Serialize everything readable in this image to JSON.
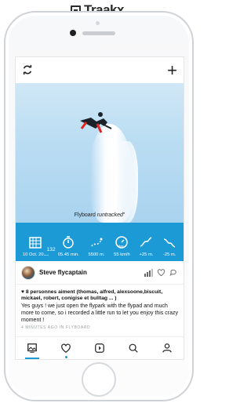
{
  "brand": {
    "name": "Traakx"
  },
  "header": {
    "sync_icon": "refresh-icon",
    "add_label": "+"
  },
  "photo": {
    "caption_label": "Flyboard",
    "caption_status": "runtracked"
  },
  "stats": [
    {
      "label": "10 Oct. 2016",
      "icon": "calendar-icon"
    },
    {
      "label": "05.45 min.",
      "icon": "timer-icon"
    },
    {
      "label": "5500 m.",
      "icon": "route-icon"
    },
    {
      "label": "55 km/h",
      "icon": "speed-icon",
      "gauge_text": "Max."
    },
    {
      "label": "+25 m.",
      "icon": "elevation-up-icon"
    },
    {
      "label": "-25 m.",
      "icon": "elevation-down-icon"
    }
  ],
  "user": {
    "name": "Steve flycaptain"
  },
  "likes": {
    "text": "♥ 8 personnes aiment (thomas, alfred, alexsoone,biscuit, mickael, robert, conigise et bulltag ... )"
  },
  "post": {
    "text": "Yes guys ! we just open the flypark with the flypad and much more to come, so i recorded a little run to let you enjoy this crazy moment !"
  },
  "meta": {
    "text": "4 MINUTES AGO IN FLYBOARD"
  },
  "badge": {
    "count": "132"
  },
  "tabs": [
    {
      "name": "feed",
      "icon": "image-icon"
    },
    {
      "name": "likes",
      "icon": "heart-icon"
    },
    {
      "name": "record",
      "icon": "record-icon"
    },
    {
      "name": "search",
      "icon": "search-icon"
    },
    {
      "name": "profile",
      "icon": "user-icon"
    }
  ],
  "colors": {
    "accent": "#1c9ad6"
  }
}
